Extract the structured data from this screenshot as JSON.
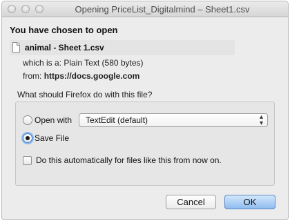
{
  "window": {
    "title": "Opening PriceList_Digitalmind – Sheet1.csv"
  },
  "dialog": {
    "heading": "You have chosen to open",
    "file_name": "animal - Sheet 1.csv",
    "type_prefix": "which is a:",
    "type_value": "Plain Text (580 bytes)",
    "from_prefix": "from:",
    "from_value": "https://docs.google.com",
    "question": "What should Firefox do with this file?",
    "options": {
      "open_with_label": "Open with",
      "open_with_app": "TextEdit (default)",
      "open_with_selected": false,
      "save_file_label": "Save File",
      "save_file_selected": true
    },
    "auto_checkbox_label": "Do this automatically for files like this from now on.",
    "auto_checkbox_checked": false,
    "buttons": {
      "cancel": "Cancel",
      "ok": "OK"
    }
  }
}
